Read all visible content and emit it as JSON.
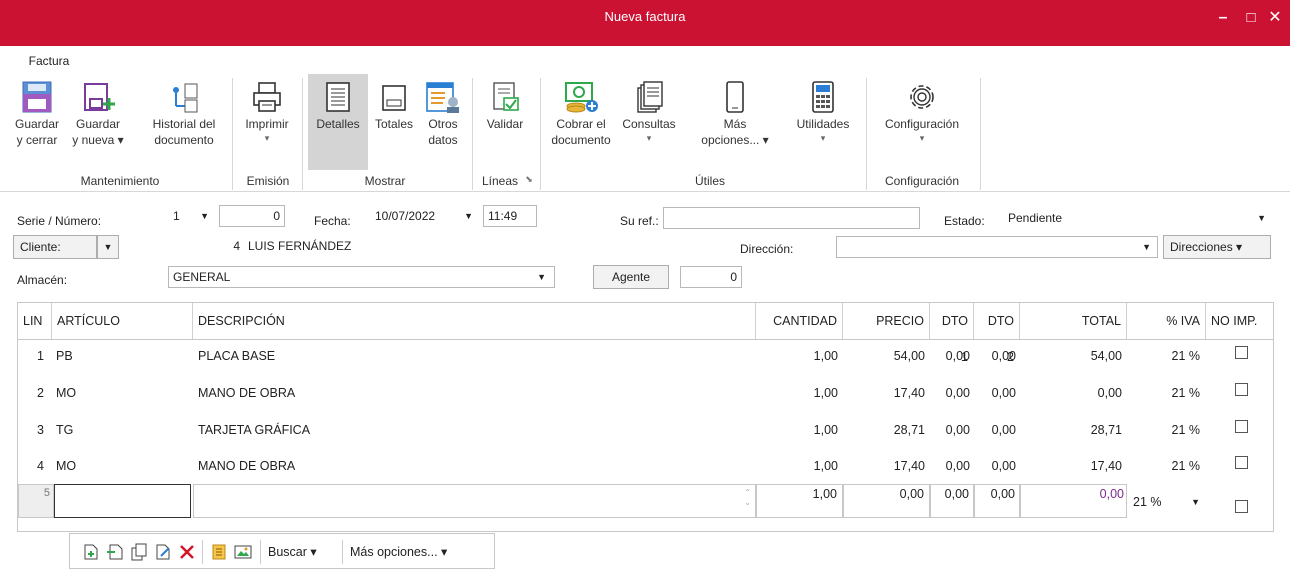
{
  "window": {
    "title": "Nueva factura",
    "minimize": "–",
    "maximize": "□",
    "close": "✕"
  },
  "tabs": {
    "factura": "Factura"
  },
  "ribbon": {
    "guardar_cerrar": [
      "Guardar",
      "y cerrar"
    ],
    "guardar_nueva": [
      "Guardar",
      "y nueva ▾"
    ],
    "historial": [
      "Historial del",
      "documento"
    ],
    "imprimir": [
      "Imprimir",
      "▾"
    ],
    "detalles": "Detalles",
    "totales": "Totales",
    "otros_datos": [
      "Otros",
      "datos"
    ],
    "validar": "Validar",
    "cobrar": [
      "Cobrar el",
      "documento"
    ],
    "consultas": [
      "Consultas",
      "▾"
    ],
    "mas_opciones": [
      "Más",
      "opciones... ▾"
    ],
    "utilidades": [
      "Utilidades",
      "▾"
    ],
    "configuracion": [
      "Configuración",
      "▾"
    ],
    "groups": {
      "mantenimiento": "Mantenimiento",
      "emision": "Emisión",
      "mostrar": "Mostrar",
      "lineas": "Líneas",
      "utiles": "Útiles",
      "configuracion": "Configuración"
    }
  },
  "form": {
    "serie_label": "Serie / Número:",
    "serie_value": "1",
    "numero_value": "0",
    "fecha_label": "Fecha:",
    "fecha_value": "10/07/2022",
    "hora_value": "11:49",
    "suref_label": "Su ref.:",
    "suref_value": "",
    "estado_label": "Estado:",
    "estado_value": "Pendiente",
    "cliente_button": "Cliente:",
    "cliente_code": "4",
    "cliente_name": "LUIS FERNÁNDEZ",
    "direccion_label": "Dirección:",
    "direccion_value": "",
    "direcciones_button": "Direcciones ▾",
    "almacen_label": "Almacén:",
    "almacen_value": "GENERAL",
    "agente_button": "Agente",
    "agente_value": "0"
  },
  "grid": {
    "headers": [
      "LIN",
      "ARTÍCULO",
      "DESCRIPCIÓN",
      "CANTIDAD",
      "PRECIO",
      "DTO 1",
      "DTO 2",
      "TOTAL",
      "% IVA",
      "NO IMP."
    ],
    "rows": [
      {
        "lin": "1",
        "articulo": "PB",
        "descripcion": "PLACA BASE",
        "cantidad": "1,00",
        "precio": "54,00",
        "dto1": "0,00",
        "dto2": "0,00",
        "total": "54,00",
        "iva": "21 %"
      },
      {
        "lin": "2",
        "articulo": "MO",
        "descripcion": "MANO DE OBRA",
        "cantidad": "1,00",
        "precio": "17,40",
        "dto1": "0,00",
        "dto2": "0,00",
        "total": "0,00",
        "iva": "21 %"
      },
      {
        "lin": "3",
        "articulo": "TG",
        "descripcion": "TARJETA GRÁFICA",
        "cantidad": "1,00",
        "precio": "28,71",
        "dto1": "0,00",
        "dto2": "0,00",
        "total": "28,71",
        "iva": "21 %"
      },
      {
        "lin": "4",
        "articulo": "MO",
        "descripcion": "MANO DE OBRA",
        "cantidad": "1,00",
        "precio": "17,40",
        "dto1": "0,00",
        "dto2": "0,00",
        "total": "17,40",
        "iva": "21 %"
      }
    ],
    "new_row": {
      "lin": "5",
      "cantidad": "1,00",
      "precio": "0,00",
      "dto1": "0,00",
      "dto2": "0,00",
      "total": "0,00",
      "iva": "21 %"
    }
  },
  "bottom_toolbar": {
    "buscar": "Buscar ▾",
    "mas_opciones": "Más opciones... ▾"
  },
  "colors": {
    "titlebar": "#cc1233",
    "accent_total": "#7a2b8c"
  }
}
